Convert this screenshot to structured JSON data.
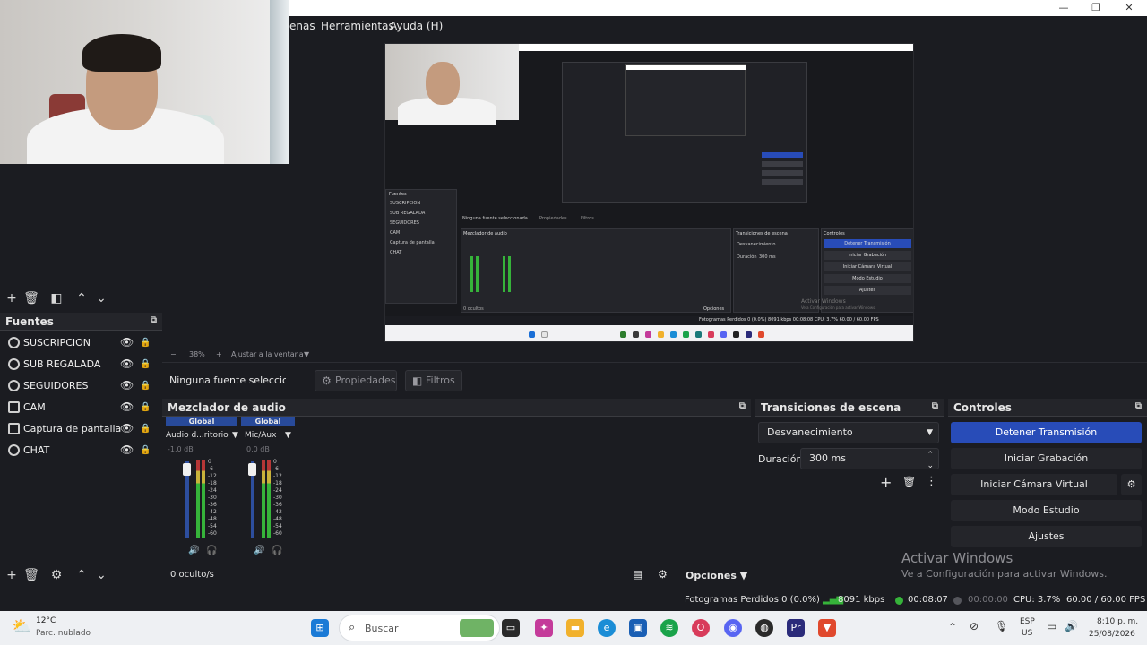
{
  "window": {
    "minimize": "—",
    "maximize": "❐",
    "close": "✕"
  },
  "menu": {
    "partial": "enas",
    "tools": "Herramientas",
    "help": "Ayuda (H)"
  },
  "preview": {
    "zoom": "38%",
    "fit_label": "Ajustar a la ventana",
    "mini_sources": [
      "SUSCRIPCION",
      "SUB REGALADA",
      "SEGUIDORES",
      "CAM",
      "Captura de pantalla",
      "CHAT"
    ],
    "mini_controls": [
      "Detener Transmisión",
      "Iniciar Grabación",
      "Iniciar Cámara Virtual",
      "Modo Estudio",
      "Ajustes"
    ],
    "mini_sources_title": "Fuentes",
    "mini_mixer_title": "Mezclador de audio",
    "mini_trans_title": "Transiciones de escena",
    "mini_controls_title": "Controles",
    "mini_nosel": "Ninguna fuente seleccionada",
    "mini_fade": "Desvanecimiento",
    "mini_duration": "Duración",
    "mini_ms": "300 ms",
    "mini_opts": "Opciones",
    "mini_hidden": "0 ocultos",
    "mini_props": "Propiedades",
    "mini_filters": "Filtros",
    "mini_status": "Fotogramas Perdidos 0 (0.0%)   8091 kbps   00:08:08   CPU: 3.7%   60.00 / 60.00 FPS",
    "mini_activate1": "Activar Windows",
    "mini_activate2": "Ve a Configuración para activar Windows."
  },
  "sources": {
    "title": "Fuentes",
    "items": [
      {
        "name": "SUSCRIPCION",
        "icon": "globe-icon"
      },
      {
        "name": "SUB REGALADA",
        "icon": "globe-icon"
      },
      {
        "name": "SEGUIDORES",
        "icon": "globe-icon"
      },
      {
        "name": "CAM",
        "icon": "camera-icon"
      },
      {
        "name": "Captura de pantalla",
        "icon": "monitor-icon"
      },
      {
        "name": "CHAT",
        "icon": "globe-icon"
      }
    ]
  },
  "context": {
    "no_selection": "Ninguna fuente seleccionada",
    "properties": "Propiedades",
    "filters": "Filtros"
  },
  "mixer": {
    "title": "Mezclador de audio",
    "channels": [
      {
        "badge": "Global",
        "name": "Audio d...ritorio",
        "db": "-1.0 dB"
      },
      {
        "badge": "Global",
        "name": "Mic/Aux",
        "db": "0.0 dB"
      }
    ],
    "scale": [
      "0",
      "-6",
      "-12",
      "-18",
      "-24",
      "-30",
      "-36",
      "-42",
      "-48",
      "-54",
      "-60"
    ],
    "hidden": "0 oculto/s",
    "options": "Opciones"
  },
  "transitions": {
    "title": "Transiciones de escena",
    "selected": "Desvanecimiento",
    "duration_label": "Duración",
    "duration_value": "300 ms"
  },
  "controls": {
    "title": "Controles",
    "stop_stream": "Detener Transmisión",
    "start_recording": "Iniciar Grabación",
    "start_virtual_cam": "Iniciar Cámara Virtual",
    "studio_mode": "Modo Estudio",
    "settings": "Ajustes"
  },
  "watermark": {
    "line1": "Activar Windows",
    "line2": "Ve a Configuración para activar Windows."
  },
  "status": {
    "dropped": "Fotogramas Perdidos 0 (0.0%)",
    "bitrate": "8091 kbps",
    "live_time": "00:08:07",
    "rec_time": "00:00:00",
    "cpu": "CPU: 3.7%",
    "fps": "60.00 / 60.00 FPS"
  },
  "taskbar": {
    "weather_temp": "12°C",
    "weather_desc": "Parc. nublado",
    "search_placeholder": "Buscar",
    "lang": "ESP",
    "region": "US",
    "time": "8:10 p. m.",
    "date": "25/08/2026"
  },
  "colors": {
    "accent": "#284cb8",
    "panel": "#1b1c21",
    "meter_green": "#36b33a",
    "meter_yellow": "#c8b23a",
    "meter_red": "#b53636"
  }
}
